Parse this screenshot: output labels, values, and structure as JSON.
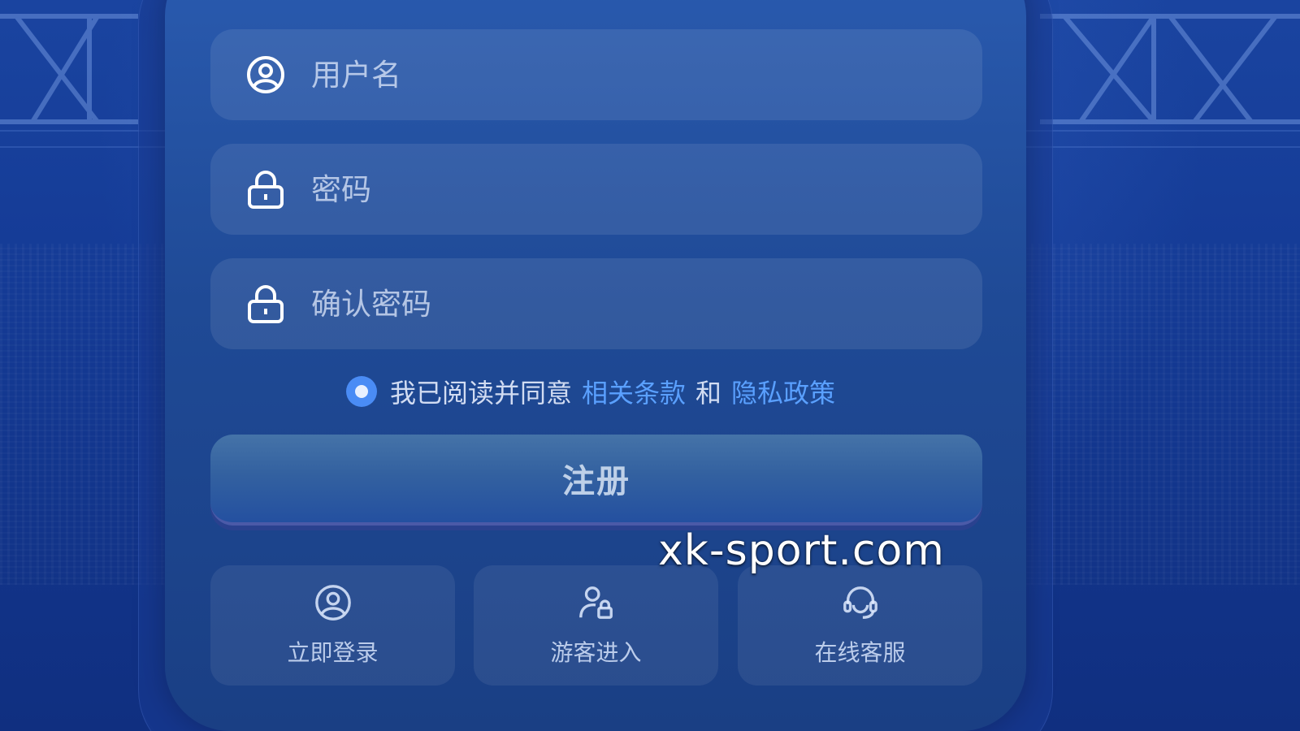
{
  "form": {
    "username_placeholder": "用户名",
    "password_placeholder": "密码",
    "confirm_password_placeholder": "确认密码"
  },
  "agreement": {
    "prefix": "我已阅读并同意",
    "terms_link": "相关条款",
    "conjunction": "和",
    "privacy_link": "隐私政策",
    "checked": true
  },
  "register_button": {
    "label": "注册"
  },
  "watermark": {
    "text": "xk-sport.com"
  },
  "quick_actions": [
    {
      "label": "立即登录",
      "icon": "user-circle-icon"
    },
    {
      "label": "游客进入",
      "icon": "guest-user-lock-icon"
    },
    {
      "label": "在线客服",
      "icon": "headset-icon"
    }
  ],
  "colors": {
    "accent": "#4a8cf5",
    "link": "#5aa0ff",
    "panel_top": "#2a5bb0",
    "panel_bottom": "#1a3f84"
  }
}
